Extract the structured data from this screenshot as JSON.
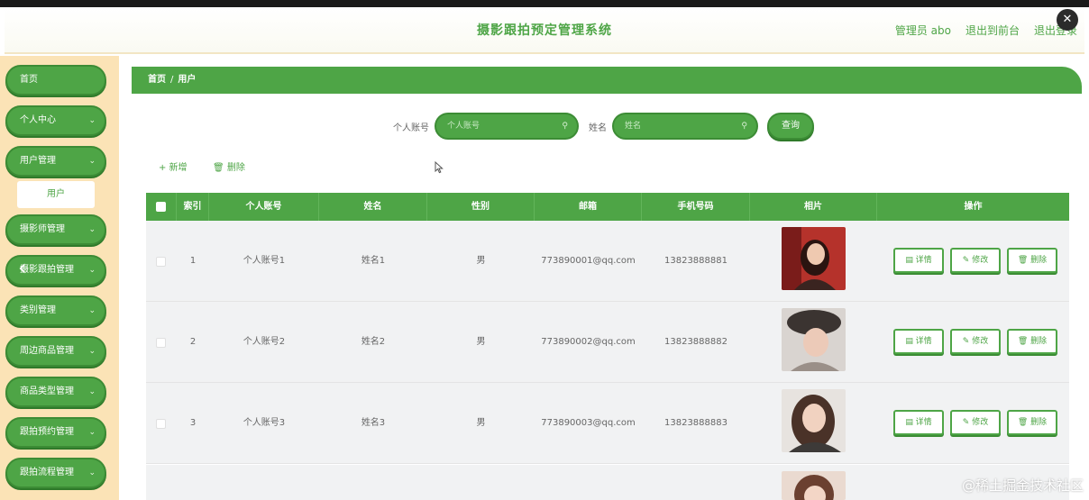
{
  "header": {
    "title": "摄影跟拍预定管理系统",
    "admin": "管理员 abo",
    "exit_front": "退出到前台",
    "logout": "退出登录"
  },
  "close_label": "✕",
  "sidebar": {
    "items": [
      {
        "label": "首页",
        "chevron": ""
      },
      {
        "label": "个人中心",
        "chevron": "⌄"
      },
      {
        "label": "用户管理",
        "chevron": "⌄"
      },
      {
        "label": "摄影师管理",
        "chevron": "⌄"
      },
      {
        "label": "摄影跟拍管理",
        "chevron": "⌄"
      },
      {
        "label": "类别管理",
        "chevron": "⌄"
      },
      {
        "label": "周边商品管理",
        "chevron": "⌄"
      },
      {
        "label": "商品类型管理",
        "chevron": "⌄"
      },
      {
        "label": "跟拍预约管理",
        "chevron": "⌄"
      },
      {
        "label": "跟拍流程管理",
        "chevron": "⌄"
      }
    ],
    "submenu": "用户"
  },
  "breadcrumb": {
    "home": "首页",
    "sep": "/",
    "current": "用户"
  },
  "search": {
    "account_label": "个人账号",
    "account_placeholder": "个人账号",
    "name_label": "姓名",
    "name_placeholder": "姓名",
    "query_label": "查询",
    "search_glyph": "⚲"
  },
  "toolbar": {
    "add_label": "+ 新增",
    "delete_label": "🗑 删除"
  },
  "table": {
    "headers": [
      "索引",
      "个人账号",
      "姓名",
      "性别",
      "邮箱",
      "手机号码",
      "相片",
      "操作"
    ],
    "rows": [
      {
        "index": "1",
        "account": "个人账号1",
        "name": "姓名1",
        "gender": "男",
        "email": "773890001@qq.com",
        "phone": "13823888881"
      },
      {
        "index": "2",
        "account": "个人账号2",
        "name": "姓名2",
        "gender": "男",
        "email": "773890002@qq.com",
        "phone": "13823888882"
      },
      {
        "index": "3",
        "account": "个人账号3",
        "name": "姓名3",
        "gender": "男",
        "email": "773890003@qq.com",
        "phone": "13823888883"
      }
    ],
    "ops": {
      "detail": "▤ 详情",
      "edit": "✎ 修改",
      "delete": "🗑 删除"
    }
  },
  "nav_arrow": "‹",
  "watermark": "@稀土掘金技术社区",
  "colors": {
    "accent": "#4ea546",
    "sidebar_bg": "#fbe3b6"
  }
}
